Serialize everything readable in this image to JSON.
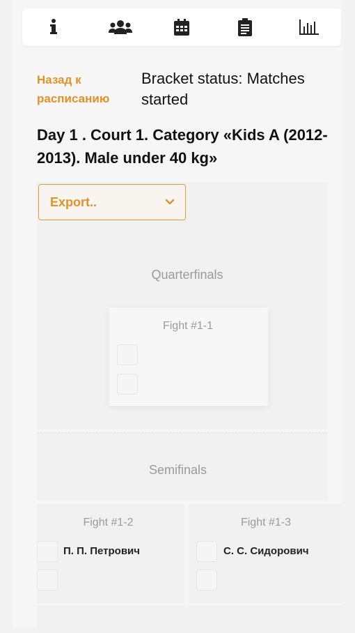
{
  "nav": {
    "items": [
      {
        "icon": "info-icon"
      },
      {
        "icon": "users-icon"
      },
      {
        "icon": "calendar-icon"
      },
      {
        "icon": "clipboard-icon"
      },
      {
        "icon": "bar-chart-icon"
      }
    ]
  },
  "header": {
    "back_label": "Назад к расписанию",
    "status": "Bracket status: Matches started",
    "title": "Day 1 . Court 1. Category «Kids A (2012-2013). Male under 40 kg»"
  },
  "export": {
    "label": "Export.."
  },
  "bracket": {
    "rounds": [
      {
        "name": "Quarterfinals",
        "fights": [
          {
            "title": "Fight #1-1",
            "fighters": [
              "",
              ""
            ]
          }
        ]
      },
      {
        "name": "Semifinals",
        "fights": [
          {
            "title": "Fight #1-2",
            "fighters": [
              "П. П. Петрович",
              ""
            ]
          },
          {
            "title": "Fight #1-3",
            "fighters": [
              "С. С. Сидорович",
              ""
            ]
          }
        ]
      }
    ]
  },
  "colors": {
    "accent": "#e0922a",
    "text": "#111111",
    "muted": "#9a9a9a",
    "background": "#f2f2f2"
  }
}
